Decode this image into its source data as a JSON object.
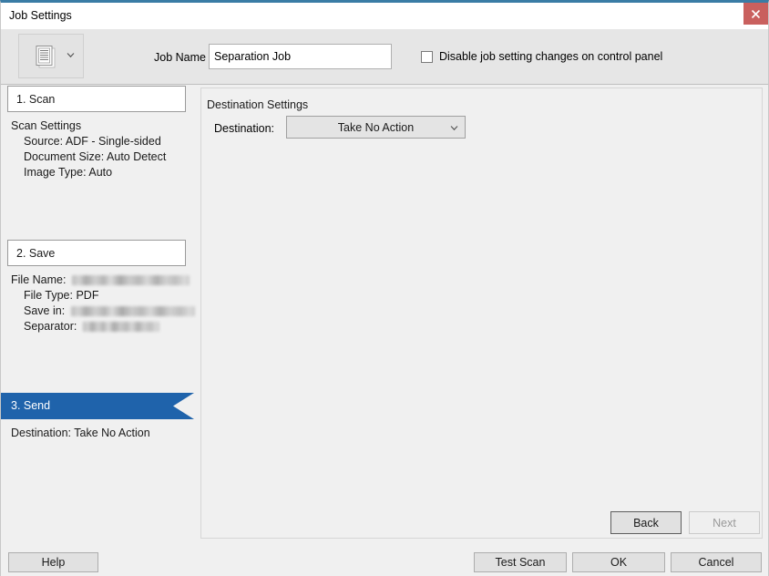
{
  "window": {
    "title": "Job Settings",
    "close_icon": "close-icon",
    "accent_color": "#3a7ca5",
    "close_button_color": "#c9605e",
    "active_step_color": "#1f63ab"
  },
  "header": {
    "job_icon": "document-stack-icon",
    "job_icon_caret": "chevron-down-icon",
    "job_name_label": "Job Name",
    "job_name_value": "Separation Job",
    "job_name_placeholder": "",
    "disable_checkbox_label": "Disable job setting changes on control panel",
    "disable_checkbox_checked": false
  },
  "sidebar": {
    "steps": [
      {
        "tab_label": "1. Scan",
        "active": false,
        "details": [
          {
            "label": "Scan Settings",
            "value": "",
            "indent": false,
            "redacted": false
          },
          {
            "label": "Source:",
            "value": "ADF - Single-sided",
            "indent": true,
            "redacted": false
          },
          {
            "label": "Document Size:",
            "value": "Auto Detect",
            "indent": true,
            "redacted": false
          },
          {
            "label": "Image Type:",
            "value": "Auto",
            "indent": true,
            "redacted": false
          }
        ]
      },
      {
        "tab_label": "2. Save",
        "active": false,
        "details": [
          {
            "label": "File Name:",
            "value": "",
            "indent": false,
            "redacted": true
          },
          {
            "label": "File Type:",
            "value": "PDF",
            "indent": true,
            "redacted": false
          },
          {
            "label": "Save in:",
            "value": "",
            "indent": true,
            "redacted": true
          },
          {
            "label": "Separator:",
            "value": "",
            "indent": true,
            "redacted": true
          }
        ]
      },
      {
        "tab_label": "3. Send",
        "active": true,
        "details": [
          {
            "label": "Destination:",
            "value": "Take No Action",
            "indent": false,
            "redacted": false
          }
        ]
      }
    ]
  },
  "main": {
    "section_title": "Destination Settings",
    "destination_label": "Destination:",
    "destination_value": "Take No Action",
    "destination_caret_icon": "chevron-down-icon",
    "back_label": "Back",
    "next_label": "Next",
    "next_disabled": true
  },
  "footer": {
    "help_label": "Help",
    "test_scan_label": "Test Scan",
    "ok_label": "OK",
    "cancel_label": "Cancel"
  }
}
